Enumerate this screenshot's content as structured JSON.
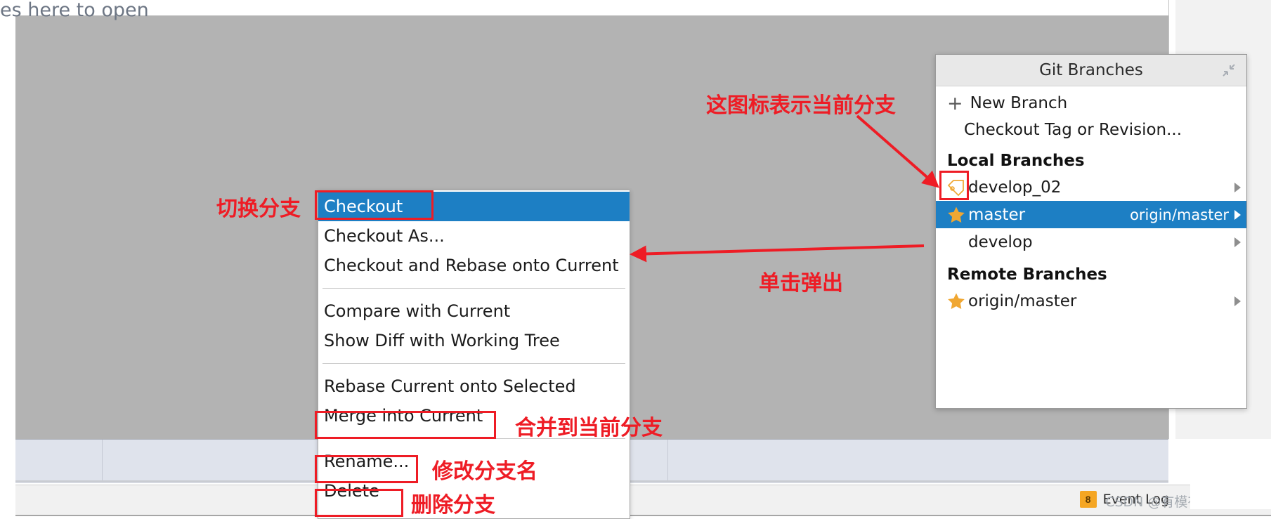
{
  "editor": {
    "hint_text": "es here to open"
  },
  "git_branches_popup": {
    "title": "Git Branches",
    "collapse_icon": "collapse-icon",
    "actions": [
      {
        "label": "New Branch",
        "icon": "plus-icon"
      },
      {
        "label": "Checkout Tag or Revision...",
        "icon": ""
      }
    ],
    "sections": [
      {
        "title": "Local Branches",
        "branches": [
          {
            "name": "develop_02",
            "icon": "tag-icon",
            "tracking": "",
            "selected": false,
            "has_submenu": true
          },
          {
            "name": "master",
            "icon": "star-icon",
            "tracking": "origin/master",
            "selected": true,
            "has_submenu": true
          },
          {
            "name": "develop",
            "icon": "",
            "tracking": "",
            "selected": false,
            "has_submenu": true
          }
        ]
      },
      {
        "title": "Remote Branches",
        "branches": [
          {
            "name": "origin/master",
            "icon": "star-icon",
            "tracking": "",
            "selected": false,
            "has_submenu": true
          }
        ]
      }
    ]
  },
  "context_menu": {
    "groups": [
      {
        "items": [
          {
            "label": "Checkout",
            "highlighted": true
          },
          {
            "label": "Checkout As...",
            "highlighted": false
          },
          {
            "label": "Checkout and Rebase onto Current",
            "highlighted": false
          }
        ]
      },
      {
        "items": [
          {
            "label": "Compare with Current",
            "highlighted": false
          },
          {
            "label": "Show Diff with Working Tree",
            "highlighted": false
          }
        ]
      },
      {
        "items": [
          {
            "label": "Rebase Current onto Selected",
            "highlighted": false
          },
          {
            "label": "Merge into Current",
            "highlighted": false
          }
        ]
      },
      {
        "items": [
          {
            "label": "Rename...",
            "highlighted": false
          },
          {
            "label": "Delete",
            "highlighted": false
          }
        ]
      }
    ]
  },
  "annotations": {
    "current_branch_icon": "这图标表示当前分支",
    "switch_branch": "切换分支",
    "click_to_popup": "单击弹出",
    "merge_into_current": "合并到当前分支",
    "rename_branch": "修改分支名",
    "delete_branch": "删除分支"
  },
  "status_bar": {
    "event_log_badge": "8",
    "event_log_label": "Event Log",
    "watermark": "CSDN @有模有样(^~^)"
  },
  "colors": {
    "annotation_red": "#EE1C25",
    "selection_blue": "#1D7FC4",
    "editor_gray": "#B3B3B3",
    "tool_window_blue": "#DFE3EC",
    "badge_orange": "#F5A623",
    "star_gold": "#F0A732"
  }
}
